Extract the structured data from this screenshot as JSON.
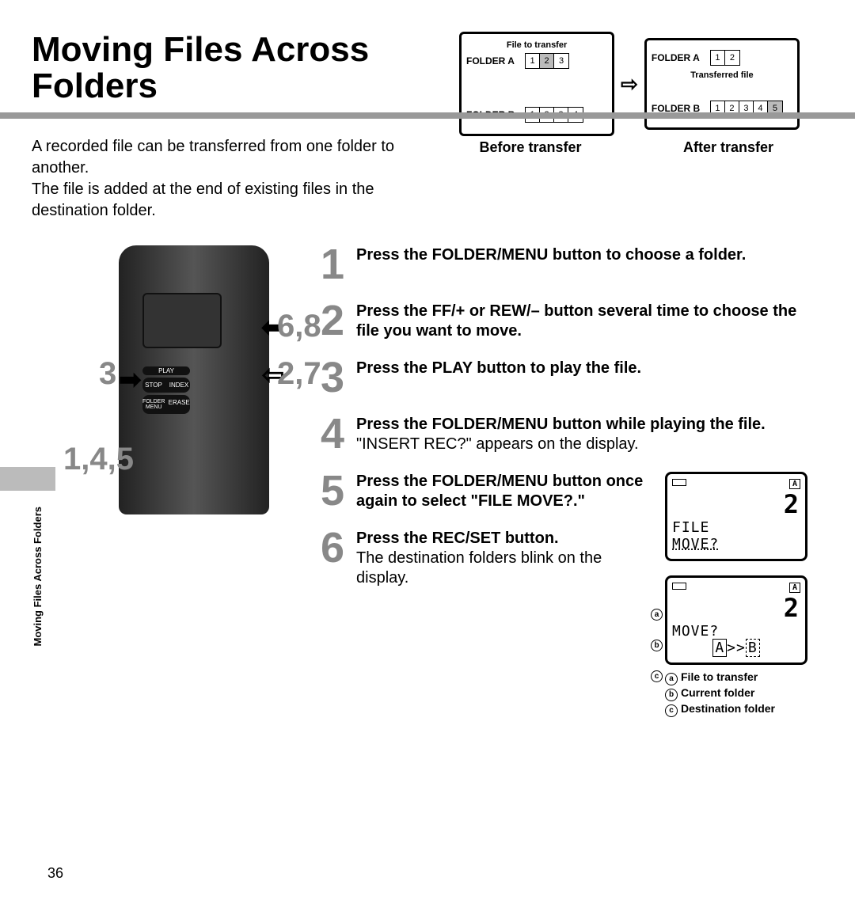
{
  "title": "Moving Files Across Folders",
  "intro_p1": "A recorded file can be transferred from one folder to another.",
  "intro_p2": "The file is added at the end of existing files in the destination folder.",
  "diagram": {
    "file_to_transfer": "File to transfer",
    "transferred_file": "Transferred file",
    "folder_a": "FOLDER A",
    "folder_b": "FOLDER B",
    "before": {
      "a": [
        "1",
        "2",
        "3"
      ],
      "b": [
        "1",
        "2",
        "3",
        "4"
      ],
      "hl_a_index": 1
    },
    "after": {
      "a": [
        "1",
        "2"
      ],
      "b": [
        "1",
        "2",
        "3",
        "4",
        "5"
      ],
      "hl_b_index": 4
    },
    "before_label": "Before transfer",
    "after_label": "After transfer",
    "arrow": "⇨"
  },
  "callouts": {
    "c68": "6,8",
    "c27": "2,7",
    "c3": "3",
    "c145": "1,4,5",
    "arrow": "➡"
  },
  "device": {
    "buttons": [
      "PLAY",
      "STOP",
      "INDEX",
      "FOLDER MENU",
      "ERASE"
    ]
  },
  "steps": [
    {
      "num": "1",
      "bold": "Press the FOLDER/MENU button to choose a folder.",
      "body": ""
    },
    {
      "num": "2",
      "bold": "Press the FF/+ or REW/– button several time to choose the file you want to move.",
      "body": ""
    },
    {
      "num": "3",
      "bold": "Press the PLAY button to play the file.",
      "body": ""
    },
    {
      "num": "4",
      "bold": "Press the FOLDER/MENU button while playing the file.",
      "body": "\"INSERT REC?\" appears on the display."
    },
    {
      "num": "5",
      "bold": "Press the FOLDER/MENU button once again to select \"FILE MOVE?.\"",
      "body": ""
    },
    {
      "num": "6",
      "bold": "Press the REC/SET button.",
      "body": "The destination folders blink on the display."
    }
  ],
  "lcd1": {
    "folder": "A",
    "num": "2",
    "line1": "FILE",
    "line2": "MOVE?"
  },
  "lcd2": {
    "folder": "A",
    "num": "2",
    "line1": "MOVE?",
    "line2": "A>>B"
  },
  "legend": {
    "a": "File to transfer",
    "b": "Current folder",
    "c": "Destination folder"
  },
  "side_tab": "Moving Files Across Folders",
  "page_number": "36"
}
